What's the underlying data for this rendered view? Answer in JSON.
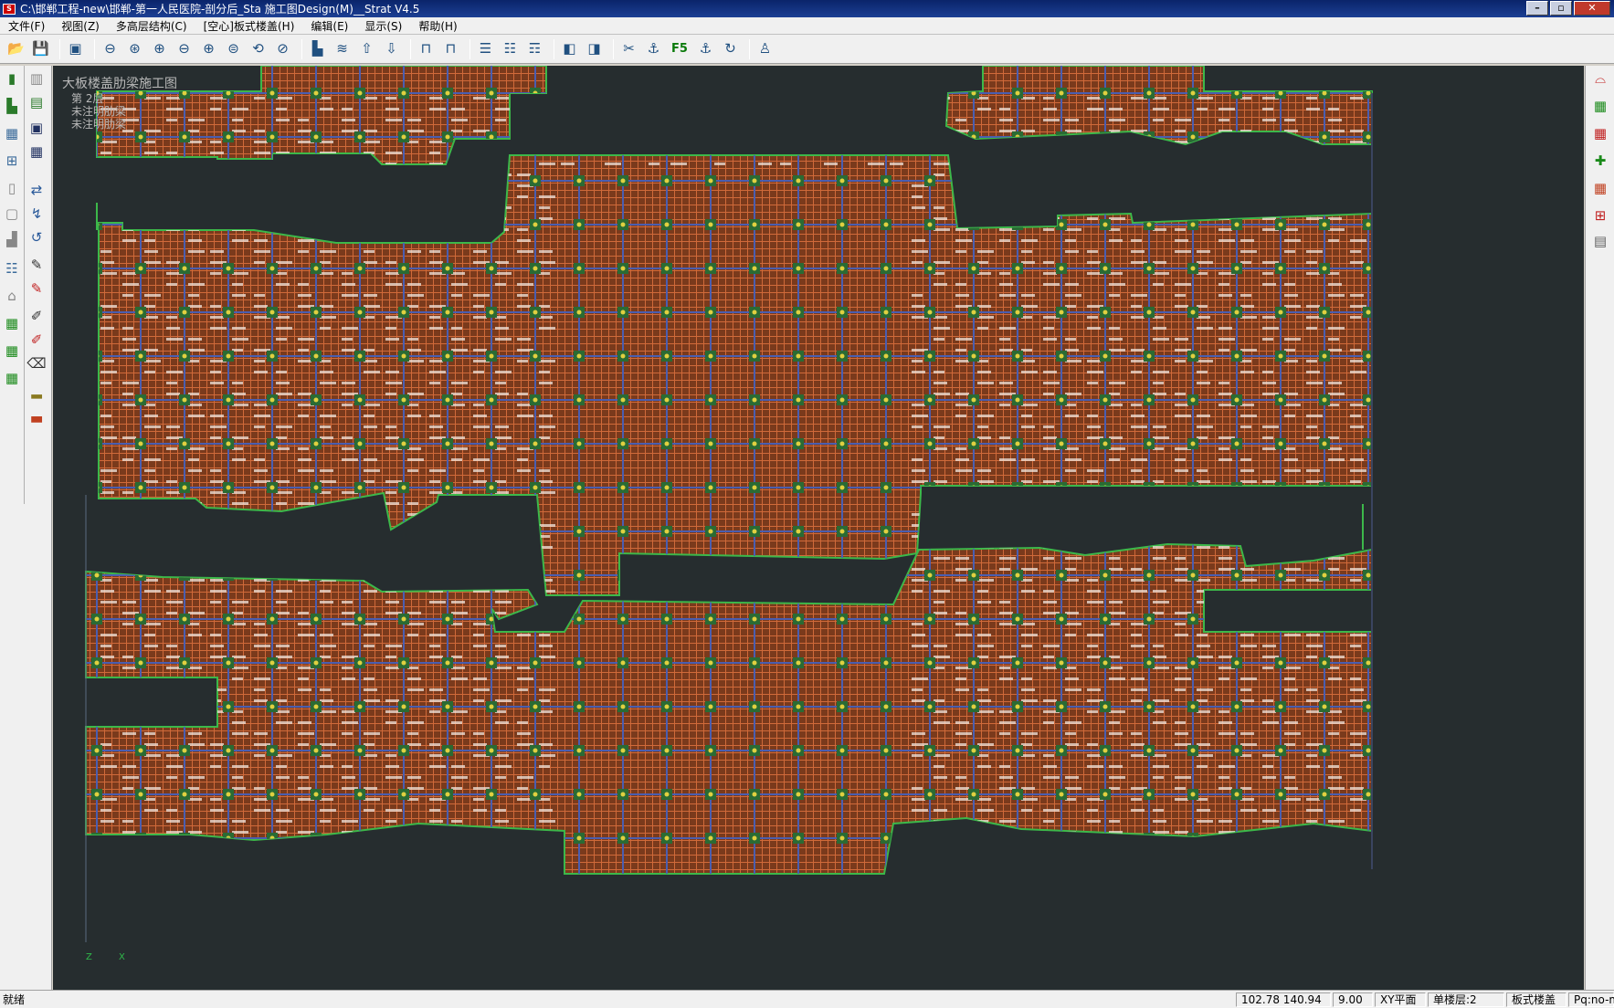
{
  "window": {
    "title": "C:\\邯郸工程-new\\邯郸-第一人民医院-剖分后_Sta  施工图Design(M)__Strat V4.5",
    "app_icon_text": "S",
    "controls": {
      "minimize": "–",
      "maximize": "▫",
      "close": "✕"
    }
  },
  "menubar": {
    "items": [
      "文件(F)",
      "视图(Z)",
      "多高层结构(C)",
      "[空心]板式楼盖(H)",
      "编辑(E)",
      "显示(S)",
      "帮助(H)"
    ]
  },
  "toolbar": {
    "f5_label": "F5",
    "buttons": [
      {
        "icon": "open-folder-icon",
        "glyph": "📂"
      },
      {
        "icon": "save-icon",
        "glyph": "💾"
      },
      {
        "icon": "preview-icon",
        "glyph": "▣"
      },
      {
        "icon": "zoom-out-icon",
        "glyph": "⊖"
      },
      {
        "icon": "zoom-all-icon",
        "glyph": "⊛"
      },
      {
        "icon": "zoom-in-icon",
        "glyph": "⊕"
      },
      {
        "icon": "zoom-minus-icon",
        "glyph": "⊖"
      },
      {
        "icon": "zoom-plus-icon",
        "glyph": "⊕"
      },
      {
        "icon": "zoom-window-icon",
        "glyph": "⊜"
      },
      {
        "icon": "zoom-realtime-icon",
        "glyph": "⟲"
      },
      {
        "icon": "zoom-previous-icon",
        "glyph": "⊘"
      },
      {
        "icon": "building-icon",
        "glyph": "▙"
      },
      {
        "icon": "layers-icon",
        "glyph": "≋"
      },
      {
        "icon": "arrow-up-icon",
        "glyph": "⇧"
      },
      {
        "icon": "arrow-down-icon",
        "glyph": "⇩"
      },
      {
        "icon": "column-icon",
        "glyph": "⊓"
      },
      {
        "icon": "column-pair-icon",
        "glyph": "⊓"
      },
      {
        "icon": "floor-stack-icon",
        "glyph": "☰"
      },
      {
        "icon": "floor-stack-edit-icon",
        "glyph": "☷"
      },
      {
        "icon": "floor-stack-check-icon",
        "glyph": "☶"
      },
      {
        "icon": "box-3d-icon",
        "glyph": "◧"
      },
      {
        "icon": "box-3d-outline-icon",
        "glyph": "◨"
      },
      {
        "icon": "trim-icon",
        "glyph": "✂"
      },
      {
        "icon": "anchor-icon",
        "glyph": "⚓"
      },
      {
        "icon": "anchor-left-icon",
        "glyph": "⚓"
      },
      {
        "icon": "rotate-icon",
        "glyph": "↻"
      },
      {
        "icon": "person-icon",
        "glyph": "♙"
      }
    ]
  },
  "left_tools": {
    "col1": [
      {
        "icon": "column-tool-icon",
        "glyph": "▮"
      },
      {
        "icon": "beam-tool-icon",
        "glyph": "▙"
      },
      {
        "icon": "slab-tool-icon",
        "glyph": "▦"
      },
      {
        "icon": "frame-tool-icon",
        "glyph": "⊞"
      },
      {
        "icon": "wall-tool-icon",
        "glyph": "▯"
      },
      {
        "icon": "opening-tool-icon",
        "glyph": "▢"
      },
      {
        "icon": "stair-tool-icon",
        "glyph": "▟"
      },
      {
        "icon": "grid-list-icon",
        "glyph": "☷"
      },
      {
        "icon": "foundation-tool-icon",
        "glyph": "⌂"
      },
      {
        "icon": "green-grid-icon",
        "glyph": "▦"
      },
      {
        "icon": "green-grid-edit-icon",
        "glyph": "▦"
      },
      {
        "icon": "green-grid-check-icon",
        "glyph": "▦"
      }
    ],
    "col2": [
      {
        "icon": "bar-chart-icon",
        "glyph": "▥"
      },
      {
        "icon": "chart-edit-icon",
        "glyph": "▤"
      },
      {
        "icon": "report-icon",
        "glyph": "▣"
      },
      {
        "icon": "table-icon",
        "glyph": "▦"
      },
      {
        "icon": "rebar-arrow-icon",
        "glyph": "⇄"
      },
      {
        "icon": "rebar-bend-icon",
        "glyph": "↯"
      },
      {
        "icon": "rebar-hook-icon",
        "glyph": "↺"
      },
      {
        "icon": "edit-pencil-icon",
        "glyph": "✎"
      },
      {
        "icon": "edit-red-icon",
        "glyph": "✎"
      },
      {
        "icon": "draw-beam-icon",
        "glyph": "✐"
      },
      {
        "icon": "draw-slab-icon",
        "glyph": "✐"
      },
      {
        "icon": "eraser-icon",
        "glyph": "⌫"
      },
      {
        "icon": "bars-icon",
        "glyph": "▂"
      },
      {
        "icon": "bars-red-icon",
        "glyph": "▃"
      }
    ]
  },
  "right_tools": [
    {
      "icon": "bridge-icon",
      "glyph": "⌓"
    },
    {
      "icon": "mesh-green-icon",
      "glyph": "▦"
    },
    {
      "icon": "mesh-red-icon",
      "glyph": "▦"
    },
    {
      "icon": "pin-icon",
      "glyph": "✚"
    },
    {
      "icon": "mesh-edit-icon",
      "glyph": "▦"
    },
    {
      "icon": "mesh-cross-icon",
      "glyph": "⊞"
    },
    {
      "icon": "grid-plain-icon",
      "glyph": "▤"
    }
  ],
  "canvas": {
    "title": "大板楼盖肋梁施工图",
    "floor": "第 2层",
    "note1": "未注明肋梁",
    "note2": "未注明肋梁",
    "axis_x": "X",
    "axis_z": "Z",
    "colors": {
      "background": "#262d2f",
      "slab_fill": "#7a3a1c",
      "rib_line": "#d06a3a",
      "main_beam": "#4a5eb0",
      "outline": "#3cb84a",
      "column": "#2a6b34",
      "column_dot": "#e0d040",
      "label_text": "#f2e6dc"
    }
  },
  "statusbar": {
    "status": "就绪",
    "coords": "102.78  140.94",
    "value": "9.00",
    "plane": "XY平面",
    "layer": "单楼层:2",
    "mode": "板式楼盖",
    "extra": "Pq:no-m"
  }
}
